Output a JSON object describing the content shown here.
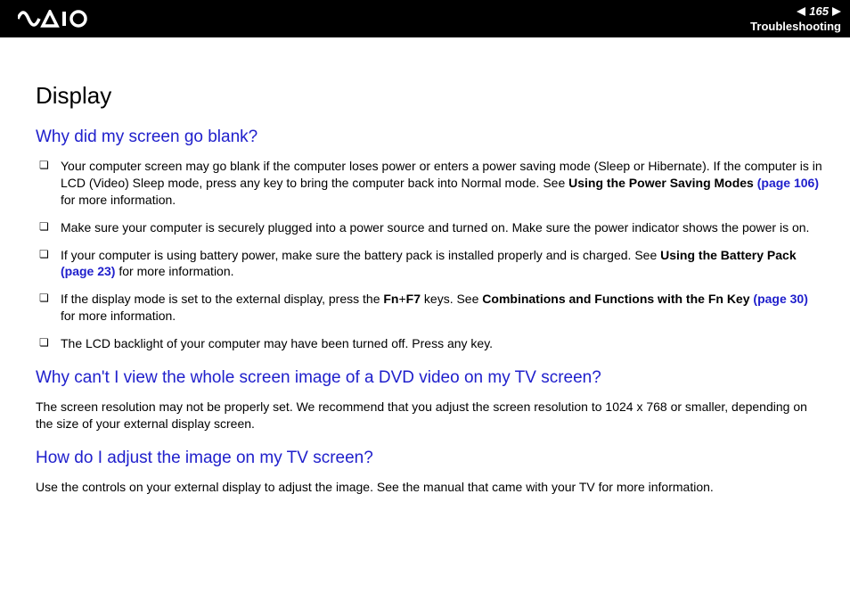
{
  "header": {
    "page_number": "165",
    "section": "Troubleshooting"
  },
  "content": {
    "h1": "Display",
    "q1": {
      "title": "Why did my screen go blank?",
      "items": [
        {
          "pre": "Your computer screen may go blank if the computer loses power or enters a power saving mode (Sleep or Hibernate). If the computer is in LCD (Video) Sleep mode, press any key to bring the computer back into Normal mode. See ",
          "bold": "Using the Power Saving Modes ",
          "link": "(page 106)",
          "post": " for more information."
        },
        {
          "pre": "Make sure your computer is securely plugged into a power source and turned on. Make sure the power indicator shows the power is on.",
          "bold": "",
          "link": "",
          "post": ""
        },
        {
          "pre": "If your computer is using battery power, make sure the battery pack is installed properly and is charged. See ",
          "bold": "Using the Battery Pack ",
          "link": "(page 23)",
          "post": " for more information."
        },
        {
          "pre": "If the display mode is set to the external display, press the ",
          "bold": "Fn",
          "mid1": "+",
          "bold2": "F7",
          "mid2": " keys. See ",
          "bold3": "Combinations and Functions with the Fn Key ",
          "link": "(page 30)",
          "post": " for more information."
        },
        {
          "pre": "The LCD backlight of your computer may have been turned off. Press any key.",
          "bold": "",
          "link": "",
          "post": ""
        }
      ]
    },
    "q2": {
      "title": "Why can't I view the whole screen image of a DVD video on my TV screen?",
      "body": "The screen resolution may not be properly set. We recommend that you adjust the screen resolution to 1024 x 768 or smaller, depending on the size of your external display screen."
    },
    "q3": {
      "title": "How do I adjust the image on my TV screen?",
      "body": "Use the controls on your external display to adjust the image. See the manual that came with your TV for more information."
    }
  }
}
